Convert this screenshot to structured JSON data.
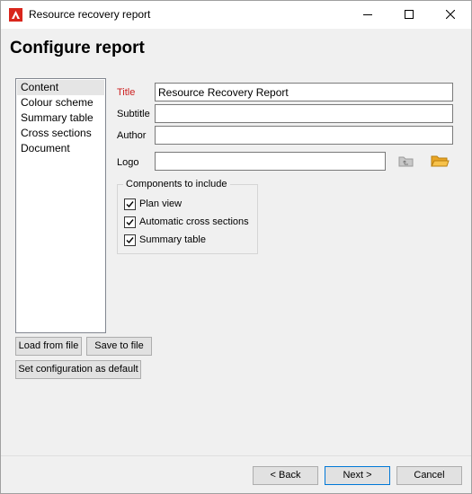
{
  "window": {
    "title": "Resource recovery report"
  },
  "header": {
    "heading": "Configure report"
  },
  "sidebar": {
    "items": [
      {
        "label": "Content",
        "selected": true
      },
      {
        "label": "Colour scheme",
        "selected": false
      },
      {
        "label": "Summary table",
        "selected": false
      },
      {
        "label": "Cross sections",
        "selected": false
      },
      {
        "label": "Document",
        "selected": false
      }
    ],
    "load_button": "Load from file",
    "save_button": "Save to file",
    "default_button": "Set configuration as default"
  },
  "form": {
    "title_label": "Title",
    "title_value": "Resource Recovery Report",
    "subtitle_label": "Subtitle",
    "subtitle_value": "",
    "author_label": "Author",
    "author_value": "",
    "logo_label": "Logo",
    "logo_value": "",
    "logo_clear_icon": "clear-logo-icon",
    "logo_browse_icon": "folder-icon"
  },
  "components": {
    "title": "Components to include",
    "items": [
      {
        "label": "Plan view",
        "checked": true
      },
      {
        "label": "Automatic cross sections",
        "checked": true
      },
      {
        "label": "Summary table",
        "checked": true
      }
    ]
  },
  "footer": {
    "back_button": "< Back",
    "next_button": "Next >",
    "cancel_button": "Cancel"
  },
  "colors": {
    "accent": "#0078d7",
    "required": "#cc1f1f",
    "brand": "#d9261c"
  }
}
